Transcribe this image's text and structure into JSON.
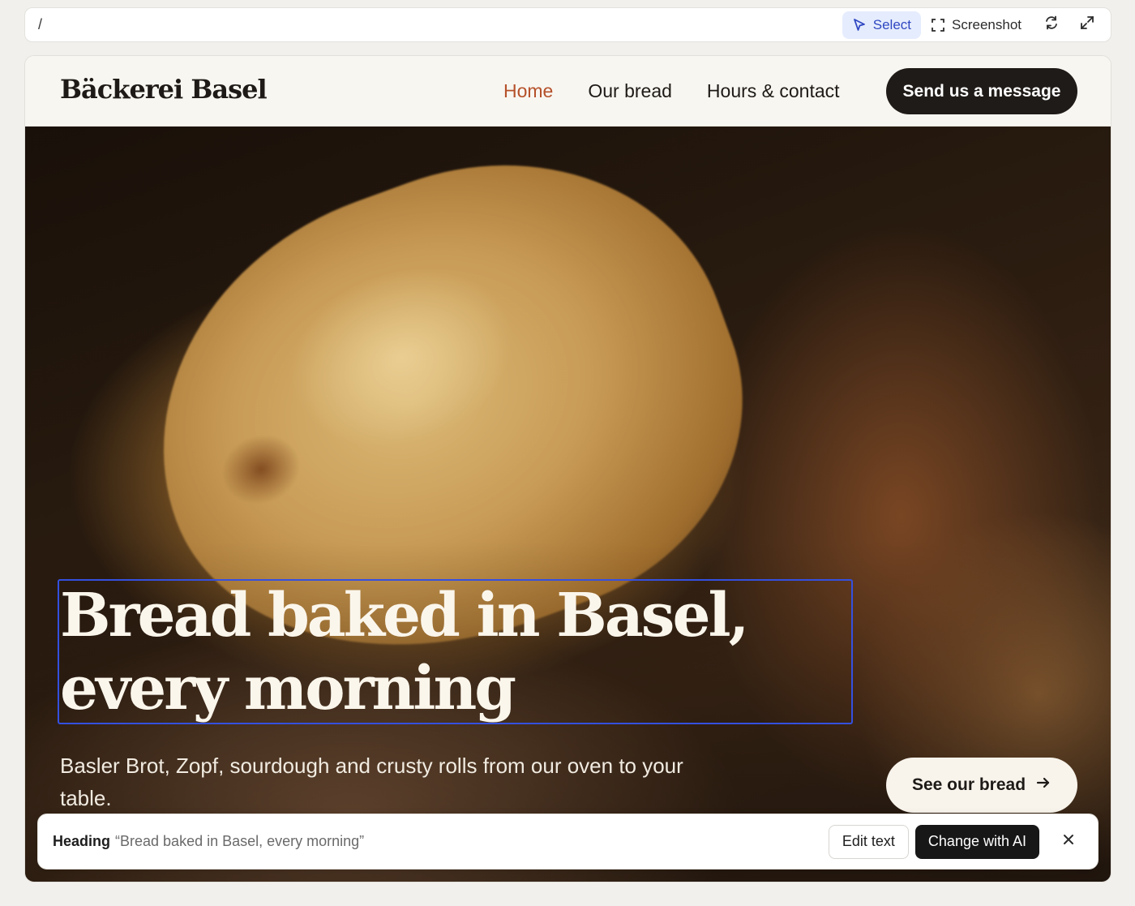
{
  "toolbar": {
    "path": "/",
    "select_label": "Select",
    "screenshot_label": "Screenshot",
    "refresh_icon": "refresh-icon",
    "expand_icon": "expand-icon",
    "accent": "#3048c2"
  },
  "site": {
    "logo": "Bäckerei Basel",
    "nav": [
      {
        "label": "Home",
        "current": true
      },
      {
        "label": "Our bread",
        "current": false
      },
      {
        "label": "Hours & contact",
        "current": false
      }
    ],
    "cta_message": "Send us a message",
    "accent": "#b5512a"
  },
  "hero": {
    "headline": "Bread baked in Basel, every morning",
    "subtext": "Basler Brot, Zopf, sourdough and crusty rolls from our oven to your table.",
    "cta_bread": "See our bread"
  },
  "inspector": {
    "type": "Heading",
    "value": "“Bread baked in Basel, every morning”",
    "edit_label": "Edit text",
    "ai_label": "Change with AI",
    "close_icon": "close-icon"
  }
}
